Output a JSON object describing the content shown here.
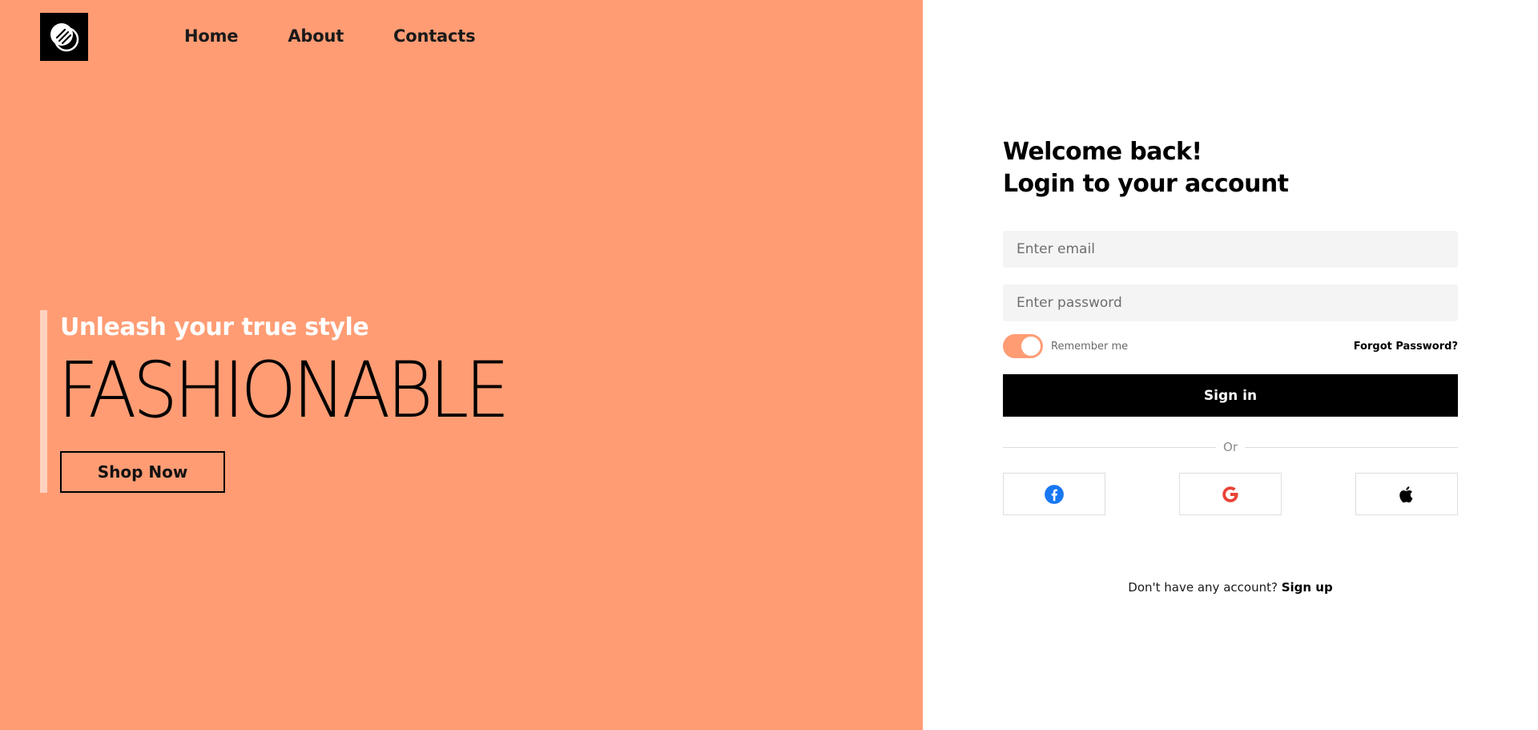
{
  "nav": {
    "logo_icon": "brand-logo-icon",
    "items": [
      {
        "label": "Home"
      },
      {
        "label": "About"
      },
      {
        "label": "Contacts"
      }
    ]
  },
  "hero": {
    "subtitle": "Unleash your true style",
    "title": "FASHIONABLE",
    "cta_label": "Shop Now"
  },
  "login": {
    "heading_line1": "Welcome back!",
    "heading_line2": "Login to your account",
    "email_placeholder": "Enter email",
    "email_value": "",
    "password_placeholder": "Enter password",
    "password_value": "",
    "remember_label": "Remember me",
    "remember_checked": true,
    "forgot_label": "Forgot Password?",
    "signin_label": "Sign in",
    "divider_label": "Or",
    "social": [
      {
        "icon": "facebook-icon",
        "color": "#1877f2"
      },
      {
        "icon": "google-icon",
        "color": "#ea4335"
      },
      {
        "icon": "apple-icon",
        "color": "#000000"
      }
    ],
    "signup_prompt": "Don't have any account?",
    "signup_label": "Sign up"
  },
  "colors": {
    "accent": "#ff9c74",
    "accent_light": "#ffd2bf",
    "primary_button": "#000000",
    "field_bg": "#f4f4f4"
  }
}
